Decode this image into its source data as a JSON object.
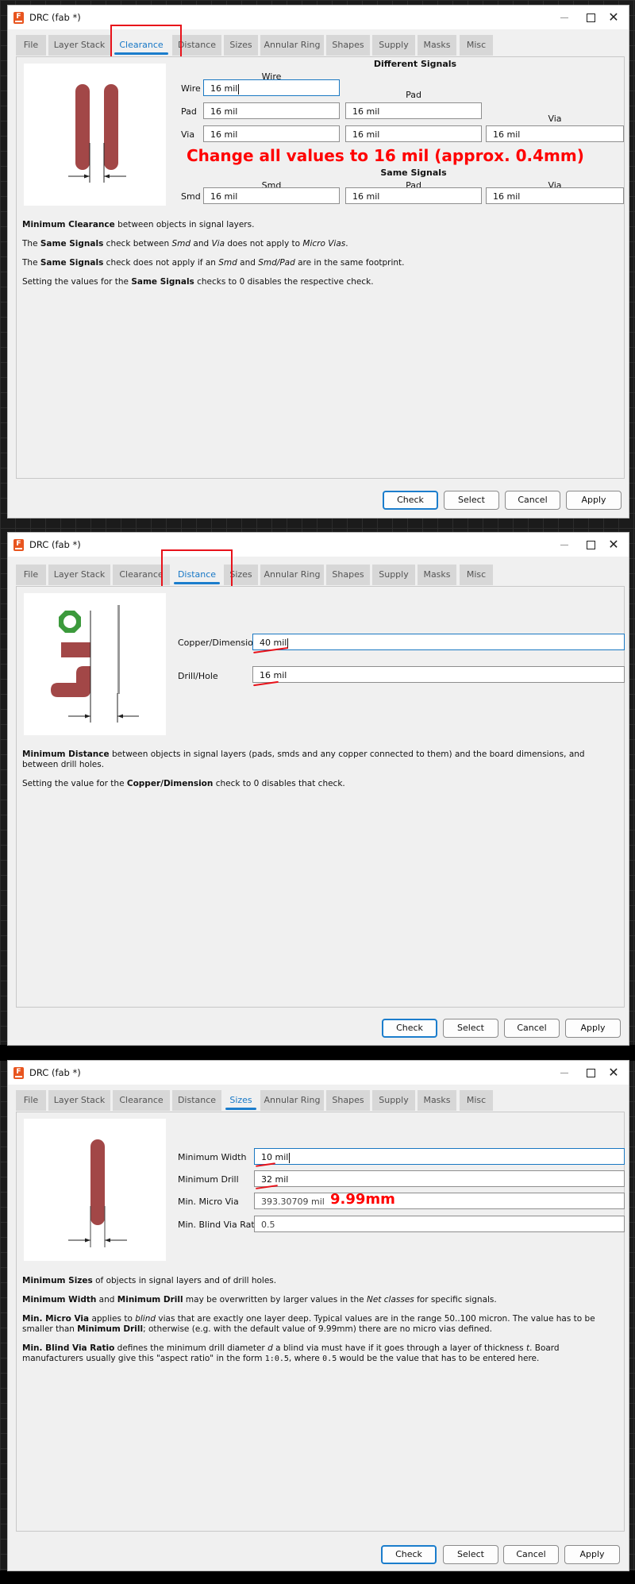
{
  "dialogs": [
    {
      "title": "DRC (fab *)",
      "tabs": [
        "File",
        "Layer Stack",
        "Clearance",
        "Distance",
        "Sizes",
        "Annular Ring",
        "Shapes",
        "Supply",
        "Masks",
        "Misc"
      ],
      "active_tab": "Clearance",
      "clearance": {
        "different_signals_heading": "Different Signals",
        "same_signals_heading": "Same Signals",
        "col_headers": {
          "wire": "Wire",
          "pad": "Pad",
          "via": "Via",
          "smd": "Smd"
        },
        "row_labels": {
          "wire": "Wire",
          "pad": "Pad",
          "via": "Via",
          "smd": "Smd"
        },
        "values": {
          "wire_wire": "16 mil",
          "pad_wire": "16 mil",
          "pad_pad": "16 mil",
          "via_wire": "16 mil",
          "via_pad": "16 mil",
          "via_via": "16 mil",
          "smd_smd": "16 mil",
          "smd_pad": "16 mil",
          "smd_via": "16 mil"
        },
        "description": {
          "p1_bold": "Minimum Clearance",
          "p1_rest": " between objects in signal layers.",
          "p2_a": "The ",
          "p2_bold": "Same Signals",
          "p2_b": " check between ",
          "p2_i1": "Smd",
          "p2_c": " and ",
          "p2_i2": "Via",
          "p2_d": " does not apply to ",
          "p2_i3": "Micro Vias",
          "p2_e": ".",
          "p3_a": "The ",
          "p3_bold": "Same Signals",
          "p3_b": " check does not apply if an ",
          "p3_i1": "Smd",
          "p3_c": " and ",
          "p3_i2": "Smd/Pad",
          "p3_d": " are in the same footprint.",
          "p4_a": "Setting the values for the ",
          "p4_bold": "Same Signals",
          "p4_b": " checks to 0 disables the respective check."
        }
      },
      "annotation": "Change all values to 16 mil (approx. 0.4mm)",
      "buttons": [
        "Check",
        "Select",
        "Cancel",
        "Apply"
      ]
    },
    {
      "title": "DRC (fab *)",
      "tabs": [
        "File",
        "Layer Stack",
        "Clearance",
        "Distance",
        "Sizes",
        "Annular Ring",
        "Shapes",
        "Supply",
        "Masks",
        "Misc"
      ],
      "active_tab": "Distance",
      "distance": {
        "copper_dimension_label": "Copper/Dimension",
        "copper_dimension_value": "40 mil",
        "drill_hole_label": "Drill/Hole",
        "drill_hole_value": "16 mil",
        "description": {
          "p1_bold": "Minimum Distance",
          "p1_rest": " between objects in signal layers (pads, smds and any copper connected to them) and the board dimensions, and between drill holes.",
          "p2_a": "Setting the value for the ",
          "p2_bold": "Copper/Dimension",
          "p2_b": " check to 0 disables that check."
        }
      },
      "buttons": [
        "Check",
        "Select",
        "Cancel",
        "Apply"
      ]
    },
    {
      "title": "DRC (fab *)",
      "tabs": [
        "File",
        "Layer Stack",
        "Clearance",
        "Distance",
        "Sizes",
        "Annular Ring",
        "Shapes",
        "Supply",
        "Masks",
        "Misc"
      ],
      "active_tab": "Sizes",
      "sizes": {
        "min_width_label": "Minimum Width",
        "min_width_value": "10 mil",
        "min_drill_label": "Minimum Drill",
        "min_drill_value": "32 mil",
        "min_micro_via_label": "Min. Micro Via",
        "min_micro_via_value": "393.30709 mil",
        "min_blind_via_ratio_label": "Min. Blind Via Ratio",
        "min_blind_via_ratio_value": "0.5",
        "description": {
          "p1_bold": "Minimum Sizes",
          "p1_rest": " of objects in signal layers and of drill holes.",
          "p2_bold1": "Minimum Width",
          "p2_a": " and ",
          "p2_bold2": "Minimum Drill",
          "p2_b": " may be overwritten by larger values in the ",
          "p2_i": "Net classes",
          "p2_c": " for specific signals.",
          "p3_bold1": "Min. Micro Via",
          "p3_a": " applies to ",
          "p3_i": "blind",
          "p3_b": " vias that are exactly one layer deep. Typical values are in the range 50..100 micron. The value has to be smaller than ",
          "p3_bold2": "Minimum Drill",
          "p3_c": "; otherwise (e.g. with the default value of 9.99mm) there are no micro vias defined.",
          "p4_bold": "Min. Blind Via Ratio",
          "p4_a": " defines the minimum drill diameter ",
          "p4_i1": "d",
          "p4_b": " a blind via must have if it goes through a layer of thickness ",
          "p4_i2": "t",
          "p4_c": ". Board manufacturers usually give this \"aspect ratio\" in the form ",
          "p4_mono1": "1:0.5",
          "p4_d": ", where ",
          "p4_mono2": "0.5",
          "p4_e": " would be the value that has to be entered here."
        }
      },
      "annotation": "9.99mm",
      "buttons": [
        "Check",
        "Select",
        "Cancel",
        "Apply"
      ]
    }
  ]
}
